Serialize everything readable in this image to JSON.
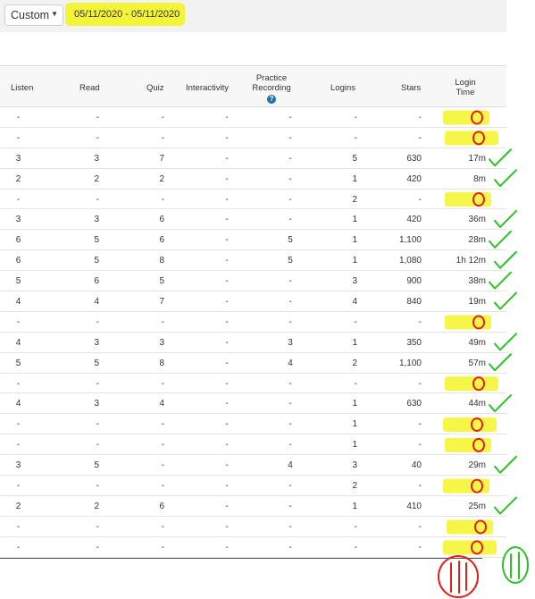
{
  "filter": {
    "range_select": "Custom",
    "date_range": "05/11/2020 - 05/11/2020"
  },
  "columns": {
    "listen": "Listen",
    "read": "Read",
    "quiz": "Quiz",
    "interactivity": "Interactivity",
    "practice_line1": "Practice",
    "practice_line2": "Recording",
    "logins": "Logins",
    "stars": "Stars",
    "login_time_line1": "Login",
    "login_time_line2": "Time",
    "help_glyph": "?"
  },
  "rows": [
    {
      "listen": "-",
      "read": "-",
      "quiz": "-",
      "interactivity": "-",
      "practice": "-",
      "logins": "-",
      "stars": "-",
      "login_time": "-"
    },
    {
      "listen": "-",
      "read": "-",
      "quiz": "-",
      "interactivity": "-",
      "practice": "-",
      "logins": "-",
      "stars": "-",
      "login_time": "-"
    },
    {
      "listen": "3",
      "read": "3",
      "quiz": "7",
      "interactivity": "-",
      "practice": "-",
      "logins": "5",
      "stars": "630",
      "login_time": "17m"
    },
    {
      "listen": "2",
      "read": "2",
      "quiz": "2",
      "interactivity": "-",
      "practice": "-",
      "logins": "1",
      "stars": "420",
      "login_time": "8m"
    },
    {
      "listen": "-",
      "read": "-",
      "quiz": "-",
      "interactivity": "-",
      "practice": "-",
      "logins": "2",
      "stars": "-",
      "login_time": "-"
    },
    {
      "listen": "3",
      "read": "3",
      "quiz": "6",
      "interactivity": "-",
      "practice": "-",
      "logins": "1",
      "stars": "420",
      "login_time": "36m"
    },
    {
      "listen": "6",
      "read": "5",
      "quiz": "6",
      "interactivity": "-",
      "practice": "5",
      "logins": "1",
      "stars": "1,100",
      "login_time": "28m"
    },
    {
      "listen": "6",
      "read": "5",
      "quiz": "8",
      "interactivity": "-",
      "practice": "5",
      "logins": "1",
      "stars": "1,080",
      "login_time": "1h 12m"
    },
    {
      "listen": "5",
      "read": "6",
      "quiz": "5",
      "interactivity": "-",
      "practice": "-",
      "logins": "3",
      "stars": "900",
      "login_time": "38m"
    },
    {
      "listen": "4",
      "read": "4",
      "quiz": "7",
      "interactivity": "-",
      "practice": "-",
      "logins": "4",
      "stars": "840",
      "login_time": "19m"
    },
    {
      "listen": "-",
      "read": "-",
      "quiz": "-",
      "interactivity": "-",
      "practice": "-",
      "logins": "-",
      "stars": "-",
      "login_time": "-"
    },
    {
      "listen": "4",
      "read": "3",
      "quiz": "3",
      "interactivity": "-",
      "practice": "3",
      "logins": "1",
      "stars": "350",
      "login_time": "49m"
    },
    {
      "listen": "5",
      "read": "5",
      "quiz": "8",
      "interactivity": "-",
      "practice": "4",
      "logins": "2",
      "stars": "1,100",
      "login_time": "57m"
    },
    {
      "listen": "-",
      "read": "-",
      "quiz": "-",
      "interactivity": "-",
      "practice": "-",
      "logins": "-",
      "stars": "-",
      "login_time": "-"
    },
    {
      "listen": "4",
      "read": "3",
      "quiz": "4",
      "interactivity": "-",
      "practice": "-",
      "logins": "1",
      "stars": "630",
      "login_time": "44m"
    },
    {
      "listen": "-",
      "read": "-",
      "quiz": "-",
      "interactivity": "-",
      "practice": "-",
      "logins": "1",
      "stars": "-",
      "login_time": "-"
    },
    {
      "listen": "-",
      "read": "-",
      "quiz": "-",
      "interactivity": "-",
      "practice": "-",
      "logins": "1",
      "stars": "-",
      "login_time": "-"
    },
    {
      "listen": "3",
      "read": "5",
      "quiz": "-",
      "interactivity": "-",
      "practice": "4",
      "logins": "3",
      "stars": "40",
      "login_time": "29m"
    },
    {
      "listen": "-",
      "read": "-",
      "quiz": "-",
      "interactivity": "-",
      "practice": "-",
      "logins": "2",
      "stars": "-",
      "login_time": "-"
    },
    {
      "listen": "2",
      "read": "2",
      "quiz": "6",
      "interactivity": "-",
      "practice": "-",
      "logins": "1",
      "stars": "410",
      "login_time": "25m"
    },
    {
      "listen": "-",
      "read": "-",
      "quiz": "-",
      "interactivity": "-",
      "practice": "-",
      "logins": "-",
      "stars": "-",
      "login_time": "-"
    },
    {
      "listen": "-",
      "read": "-",
      "quiz": "-",
      "interactivity": "-",
      "practice": "-",
      "logins": "-",
      "stars": "-",
      "login_time": "-"
    }
  ],
  "annotations": {
    "highlight_color": "#f5f53a",
    "zero_mark_color": "#e0201c",
    "check_color": "#2ec02a",
    "zero_rows": [
      0,
      1,
      4,
      10,
      13,
      15,
      16,
      18,
      20,
      21
    ],
    "check_rows": [
      2,
      3,
      5,
      6,
      7,
      8,
      9,
      11,
      12,
      14,
      17,
      19
    ],
    "tally_zero_icon": "tally-marks-icon",
    "tally_check_icon": "tally-check-icon",
    "check_icon": "checkmark-icon",
    "zero_icon": "zero-circle-icon"
  }
}
